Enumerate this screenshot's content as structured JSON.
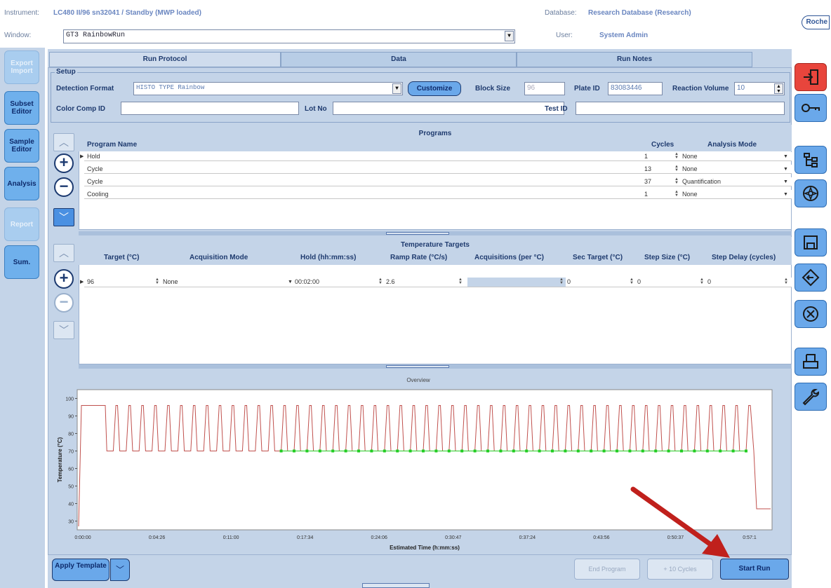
{
  "header": {
    "instrument_label": "Instrument:",
    "instrument_value": "LC480 II/96 sn32041 / Standby (MWP loaded)",
    "database_label": "Database:",
    "database_value": "Research Database (Research)",
    "window_label": "Window:",
    "window_value": "GT3 RainbowRun",
    "user_label": "User:",
    "user_value": "System Admin",
    "logo_text": "Roche"
  },
  "left_nav": {
    "export_import": "Export Import",
    "subset_editor": "Subset Editor",
    "sample_editor": "Sample Editor",
    "analysis": "Analysis",
    "report": "Report",
    "sum": "Sum."
  },
  "tabs": [
    "Run Protocol",
    "Data",
    "Run Notes"
  ],
  "setup": {
    "title": "Setup",
    "detection_format_label": "Detection Format",
    "detection_format_value": "HISTO TYPE Rainbow",
    "customize_label": "Customize",
    "block_size_label": "Block Size",
    "block_size_value": "96",
    "plate_id_label": "Plate ID",
    "plate_id_value": "83083446",
    "reaction_volume_label": "Reaction Volume",
    "reaction_volume_value": "10",
    "color_comp_label": "Color Comp ID",
    "lot_no_label": "Lot No",
    "test_id_label": "Test ID"
  },
  "programs": {
    "title": "Programs",
    "col_name": "Program Name",
    "col_cycles": "Cycles",
    "col_mode": "Analysis Mode",
    "rows": [
      {
        "name": "Hold",
        "cycles": "1",
        "mode": "None"
      },
      {
        "name": "Cycle",
        "cycles": "13",
        "mode": "None"
      },
      {
        "name": "Cycle",
        "cycles": "37",
        "mode": "Quantification"
      },
      {
        "name": "Cooling",
        "cycles": "1",
        "mode": "None"
      }
    ]
  },
  "targets": {
    "title": "Temperature Targets",
    "cols": [
      "Target (°C)",
      "Acquisition Mode",
      "Hold (hh:mm:ss)",
      "Ramp Rate (°C/s)",
      "Acquisitions (per °C)",
      "Sec Target (°C)",
      "Step Size (°C)",
      "Step Delay (cycles)"
    ],
    "row": {
      "target": "96",
      "acq_mode": "None",
      "hold": "00:02:00",
      "ramp": "2.6",
      "acquisitions": "",
      "sec_target": "0",
      "step_size": "0",
      "step_delay": "0"
    }
  },
  "chart_data": {
    "type": "line",
    "title": "Overview",
    "xlabel": "Estimated Time (h:mm:ss)",
    "ylabel": "Temperature (°C)",
    "ylim": [
      25,
      105
    ],
    "y_ticks": [
      "30",
      "40",
      "50",
      "60",
      "70",
      "80",
      "90",
      "100"
    ],
    "x_ticks": [
      "0:00:00",
      "0:04:26",
      "0:11:00",
      "0:17:34",
      "0:24:06",
      "0:30:47",
      "0:37:24",
      "0:43:56",
      "0:50:37",
      "0:57:1"
    ],
    "line_color": "#c0504d",
    "acquisition_color": "#22cc22",
    "program": {
      "hold_temp": 96,
      "hold_duration_s": 120,
      "cycle_high": 96,
      "cycle_low": 70,
      "cycles_stage1": 13,
      "cycles_stage2": 37,
      "cooling_temp": 37
    }
  },
  "footer": {
    "apply_template": "Apply Template",
    "end_program": "End Program",
    "plus_cycles": "+ 10 Cycles",
    "start_run": "Start Run"
  },
  "colors": {
    "accent": "#6fb0ec",
    "panel": "#c4d4e8",
    "exit_red": "#e8453c",
    "annotation_arrow": "#c0201c"
  }
}
